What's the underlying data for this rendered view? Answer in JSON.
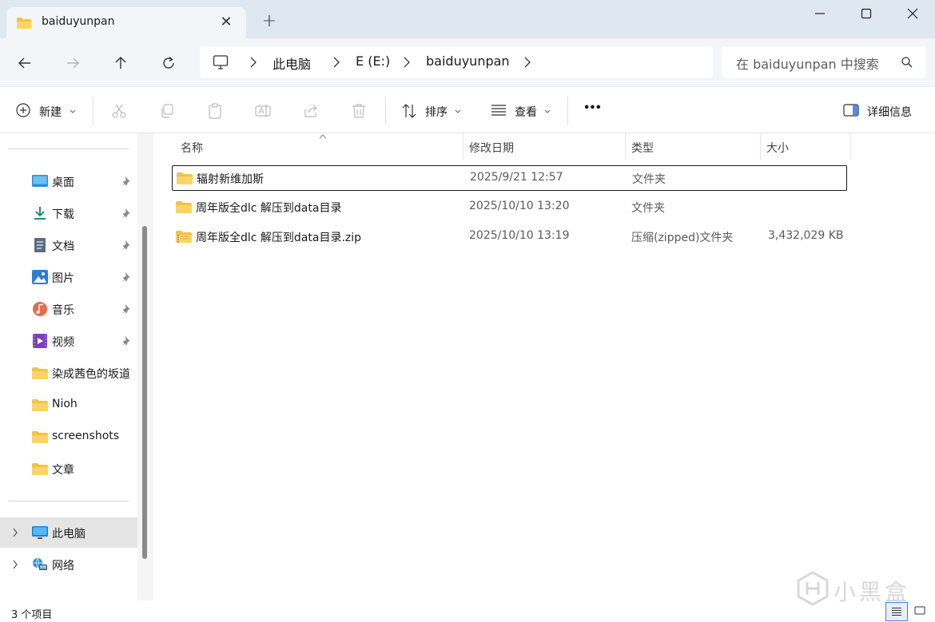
{
  "tab": {
    "title": "baiduyunpan",
    "close_glyph": "✕",
    "new_tab_glyph": "+"
  },
  "window_controls": {
    "minimize": "minimize-icon",
    "maximize": "maximize-icon",
    "close": "close-icon"
  },
  "nav": {
    "breadcrumb": [
      "此电脑",
      "E (E:)",
      "baiduyunpan"
    ],
    "search_placeholder": "在 baiduyunpan 中搜索"
  },
  "toolbar": {
    "new_label": "新建",
    "sort_label": "排序",
    "view_label": "查看",
    "more_glyph": "•••",
    "details_label": "详细信息"
  },
  "sidebar": {
    "quick_access": [
      {
        "label": "桌面",
        "icon": "desktop-icon",
        "pinned": true
      },
      {
        "label": "下载",
        "icon": "download-icon",
        "pinned": true
      },
      {
        "label": "文档",
        "icon": "document-icon",
        "pinned": true
      },
      {
        "label": "图片",
        "icon": "pictures-icon",
        "pinned": true
      },
      {
        "label": "音乐",
        "icon": "music-icon",
        "pinned": true
      },
      {
        "label": "视频",
        "icon": "video-icon",
        "pinned": true
      },
      {
        "label": "染成茜色的坂道",
        "icon": "folder-icon",
        "pinned": false
      },
      {
        "label": "Nioh",
        "icon": "folder-icon",
        "pinned": false
      },
      {
        "label": "screenshots",
        "icon": "folder-icon",
        "pinned": false
      },
      {
        "label": "文章",
        "icon": "folder-icon",
        "pinned": false
      }
    ],
    "this_pc": "此电脑",
    "network": "网络"
  },
  "columns": {
    "name": "名称",
    "modified": "修改日期",
    "type": "类型",
    "size": "大小"
  },
  "files": [
    {
      "name": "辐射新维加斯",
      "modified": "2025/9/21 12:57",
      "type": "文件夹",
      "size": "",
      "icon": "folder-icon"
    },
    {
      "name": "周年版全dlc 解压到data目录",
      "modified": "2025/10/10 13:20",
      "type": "文件夹",
      "size": "",
      "icon": "folder-icon"
    },
    {
      "name": "周年版全dlc 解压到data目录.zip",
      "modified": "2025/10/10 13:19",
      "type": "压缩(zipped)文件夹",
      "size": "3,432,029 KB",
      "icon": "zip-folder-icon"
    }
  ],
  "status": {
    "item_count": "3 个项目"
  },
  "watermark": {
    "text": "小黑盒"
  }
}
